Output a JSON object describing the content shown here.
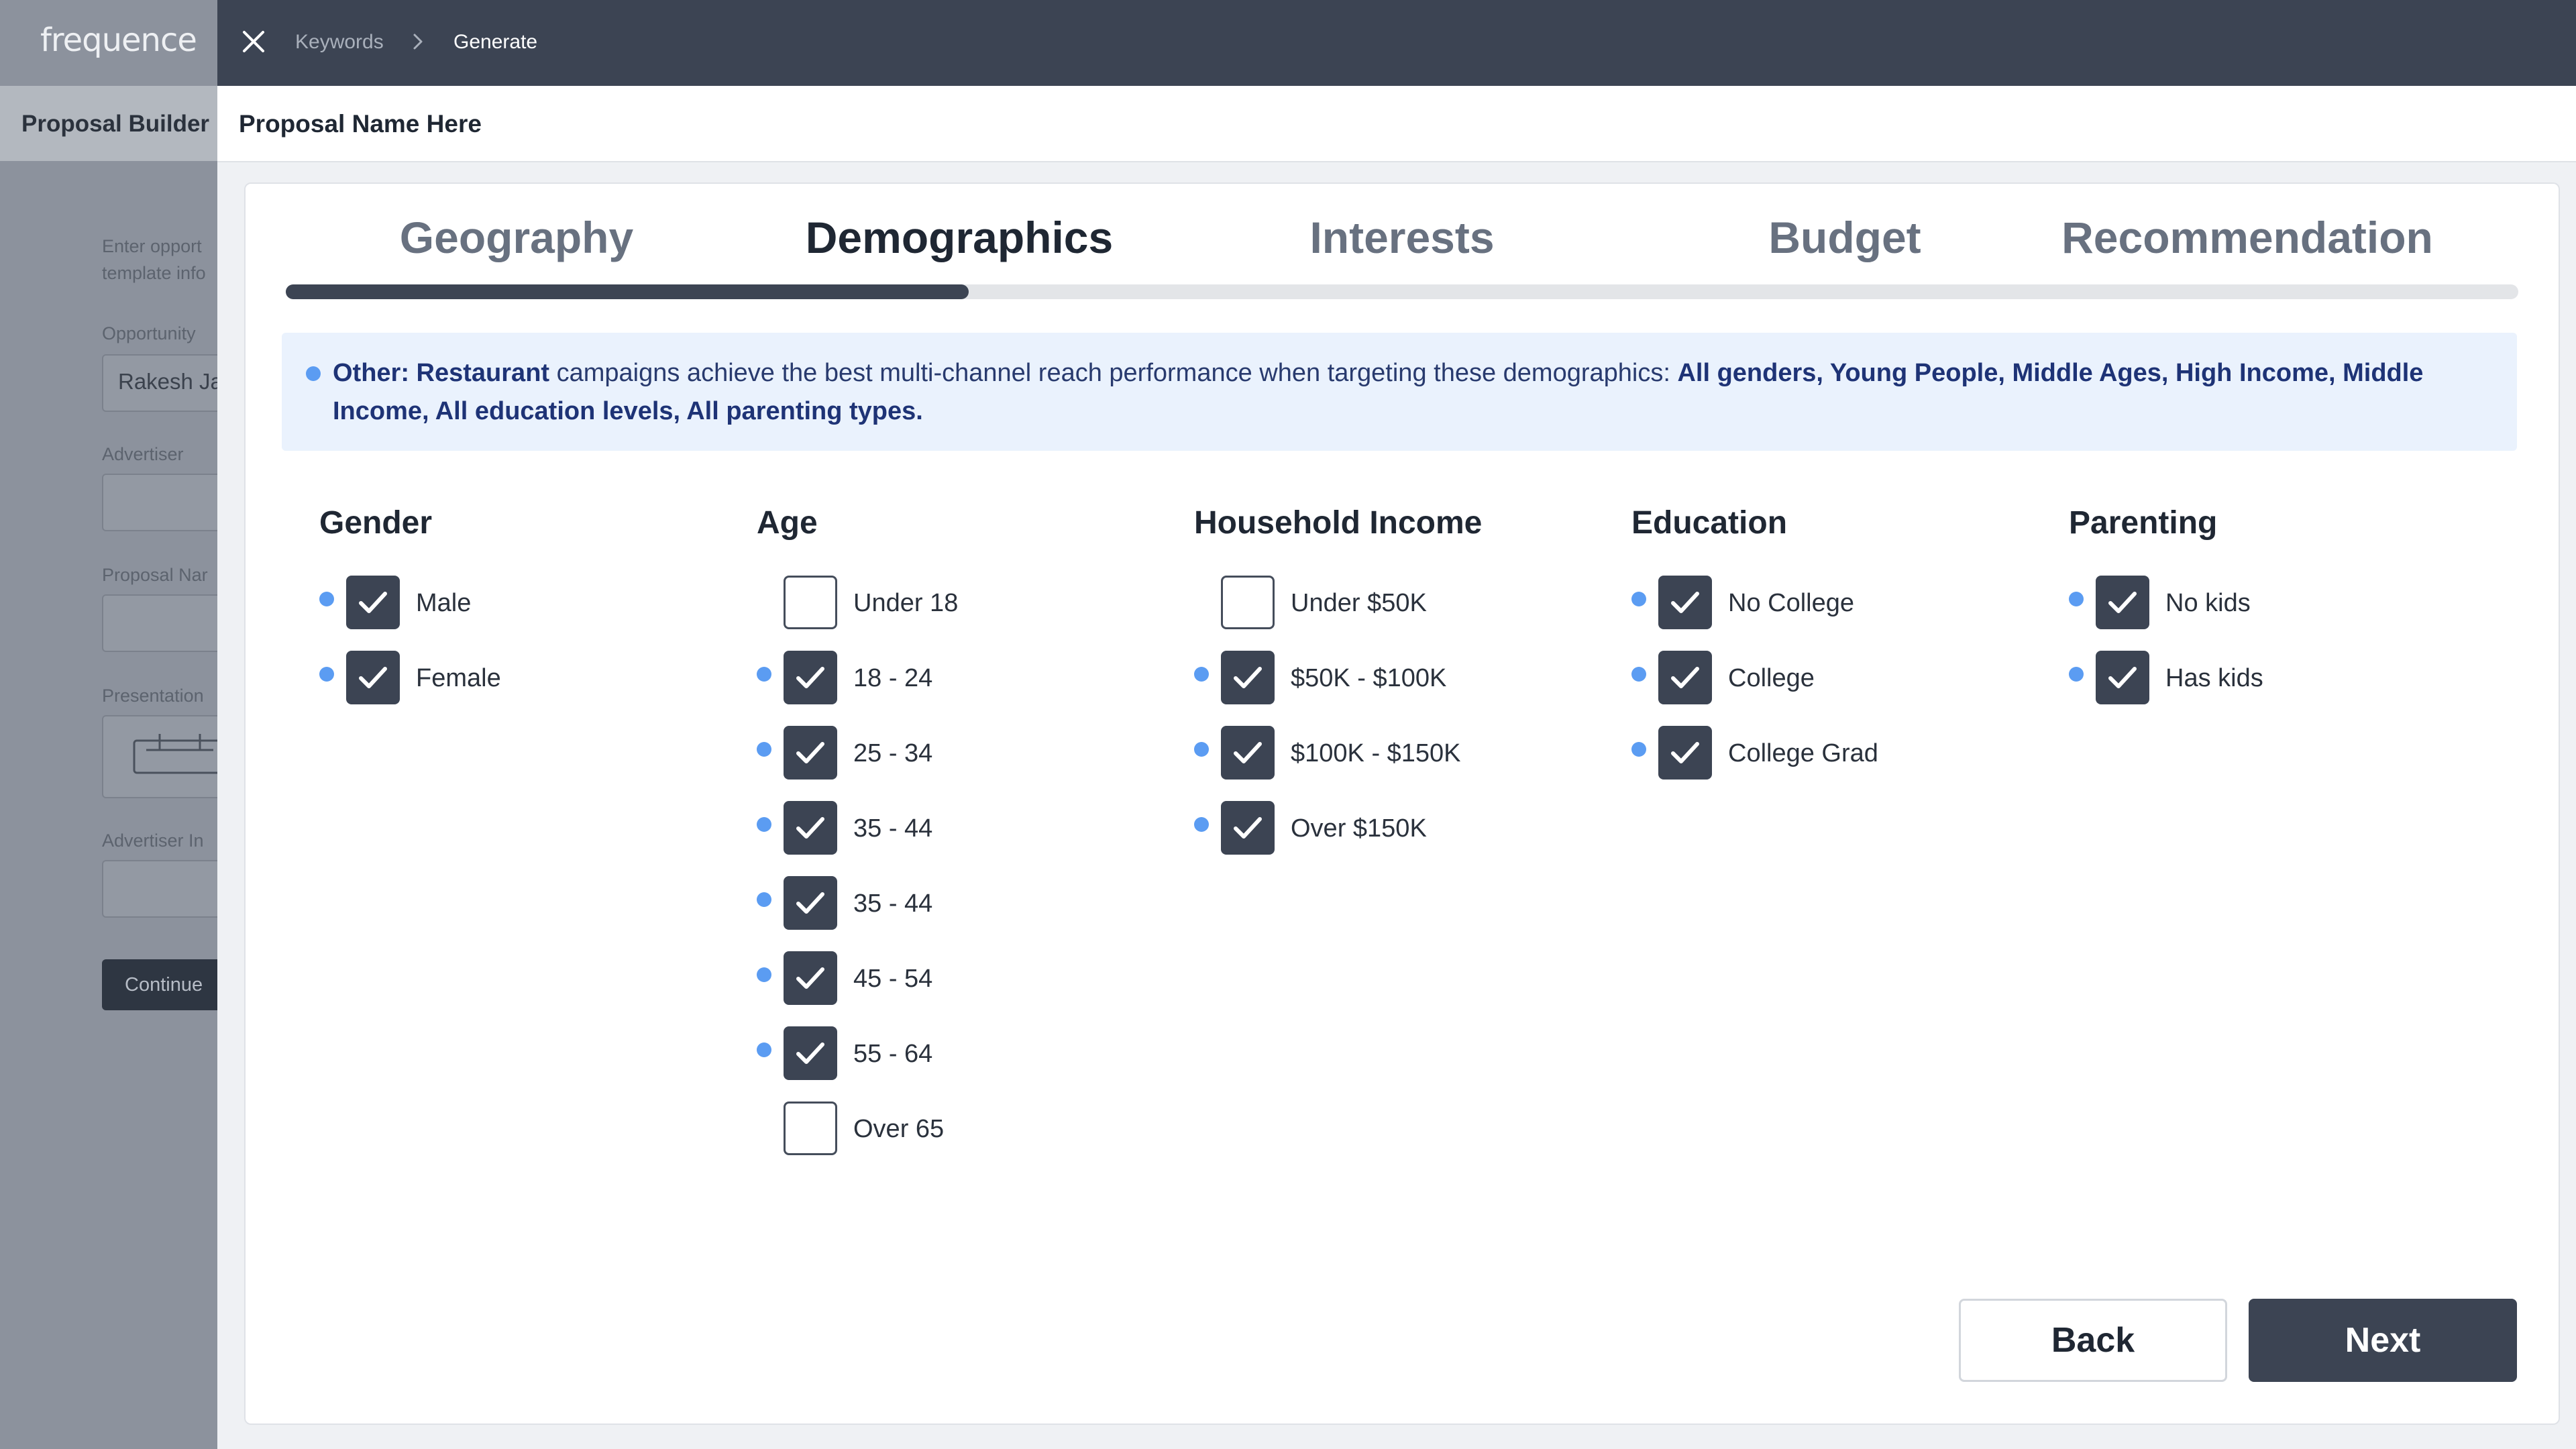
{
  "left_app": {
    "logo": "frequence",
    "title": "Proposal Builder",
    "help_text_line1": "Enter opport",
    "help_text_line2": "template info",
    "labels": [
      "Opportunity",
      "Advertiser",
      "Proposal Nar",
      "Presentation",
      "Advertiser In"
    ],
    "opportunity_value": "Rakesh Ja",
    "continue_label": "Continue"
  },
  "topbar": {
    "breadcrumb_1": "Keywords",
    "breadcrumb_2": "Generate"
  },
  "modal": {
    "proposal_name": "Proposal Name Here",
    "tabs": [
      {
        "label": "Geography",
        "active": false
      },
      {
        "label": "Demographics",
        "active": true
      },
      {
        "label": "Interests",
        "active": false
      },
      {
        "label": "Budget",
        "active": false
      },
      {
        "label": "Recommendation",
        "active": false
      }
    ],
    "progress_fraction": 0.306,
    "callout": {
      "category": "Other: Restaurant",
      "text": " campaigns achieve the best multi-channel reach performance when targeting these demographics: ",
      "targets": "All genders, Young People, Middle Ages, High Income, Middle Income, All education levels, All parenting types."
    },
    "columns": [
      {
        "heading": "Gender",
        "options": [
          {
            "label": "Male",
            "checked": true,
            "recommended": true
          },
          {
            "label": "Female",
            "checked": true,
            "recommended": true
          }
        ]
      },
      {
        "heading": "Age",
        "options": [
          {
            "label": "Under 18",
            "checked": false,
            "recommended": false
          },
          {
            "label": "18 - 24",
            "checked": true,
            "recommended": true
          },
          {
            "label": "25 - 34",
            "checked": true,
            "recommended": true
          },
          {
            "label": "35 - 44",
            "checked": true,
            "recommended": true
          },
          {
            "label": "35 - 44",
            "checked": true,
            "recommended": true
          },
          {
            "label": "45 - 54",
            "checked": true,
            "recommended": true
          },
          {
            "label": "55 - 64",
            "checked": true,
            "recommended": true
          },
          {
            "label": "Over 65",
            "checked": false,
            "recommended": false
          }
        ]
      },
      {
        "heading": "Household Income",
        "options": [
          {
            "label": "Under $50K",
            "checked": false,
            "recommended": false
          },
          {
            "label": "$50K - $100K",
            "checked": true,
            "recommended": true
          },
          {
            "label": "$100K - $150K",
            "checked": true,
            "recommended": true
          },
          {
            "label": "Over $150K",
            "checked": true,
            "recommended": true
          }
        ]
      },
      {
        "heading": "Education",
        "options": [
          {
            "label": "No College",
            "checked": true,
            "recommended": true
          },
          {
            "label": "College",
            "checked": true,
            "recommended": true
          },
          {
            "label": "College Grad",
            "checked": true,
            "recommended": true
          }
        ]
      },
      {
        "heading": "Parenting",
        "options": [
          {
            "label": "No kids",
            "checked": true,
            "recommended": true
          },
          {
            "label": "Has kids",
            "checked": true,
            "recommended": true
          }
        ]
      }
    ],
    "back_label": "Back",
    "next_label": "Next"
  },
  "colors": {
    "accent_dark": "#3c4453",
    "recommend_dot": "#5b9cf2",
    "callout_bg": "#eaf2fd"
  },
  "icons": {
    "close": "close-icon",
    "breadcrumb_separator": "chevron-right-icon",
    "checkbox_check": "check-icon",
    "recommendation": "dot-icon"
  }
}
